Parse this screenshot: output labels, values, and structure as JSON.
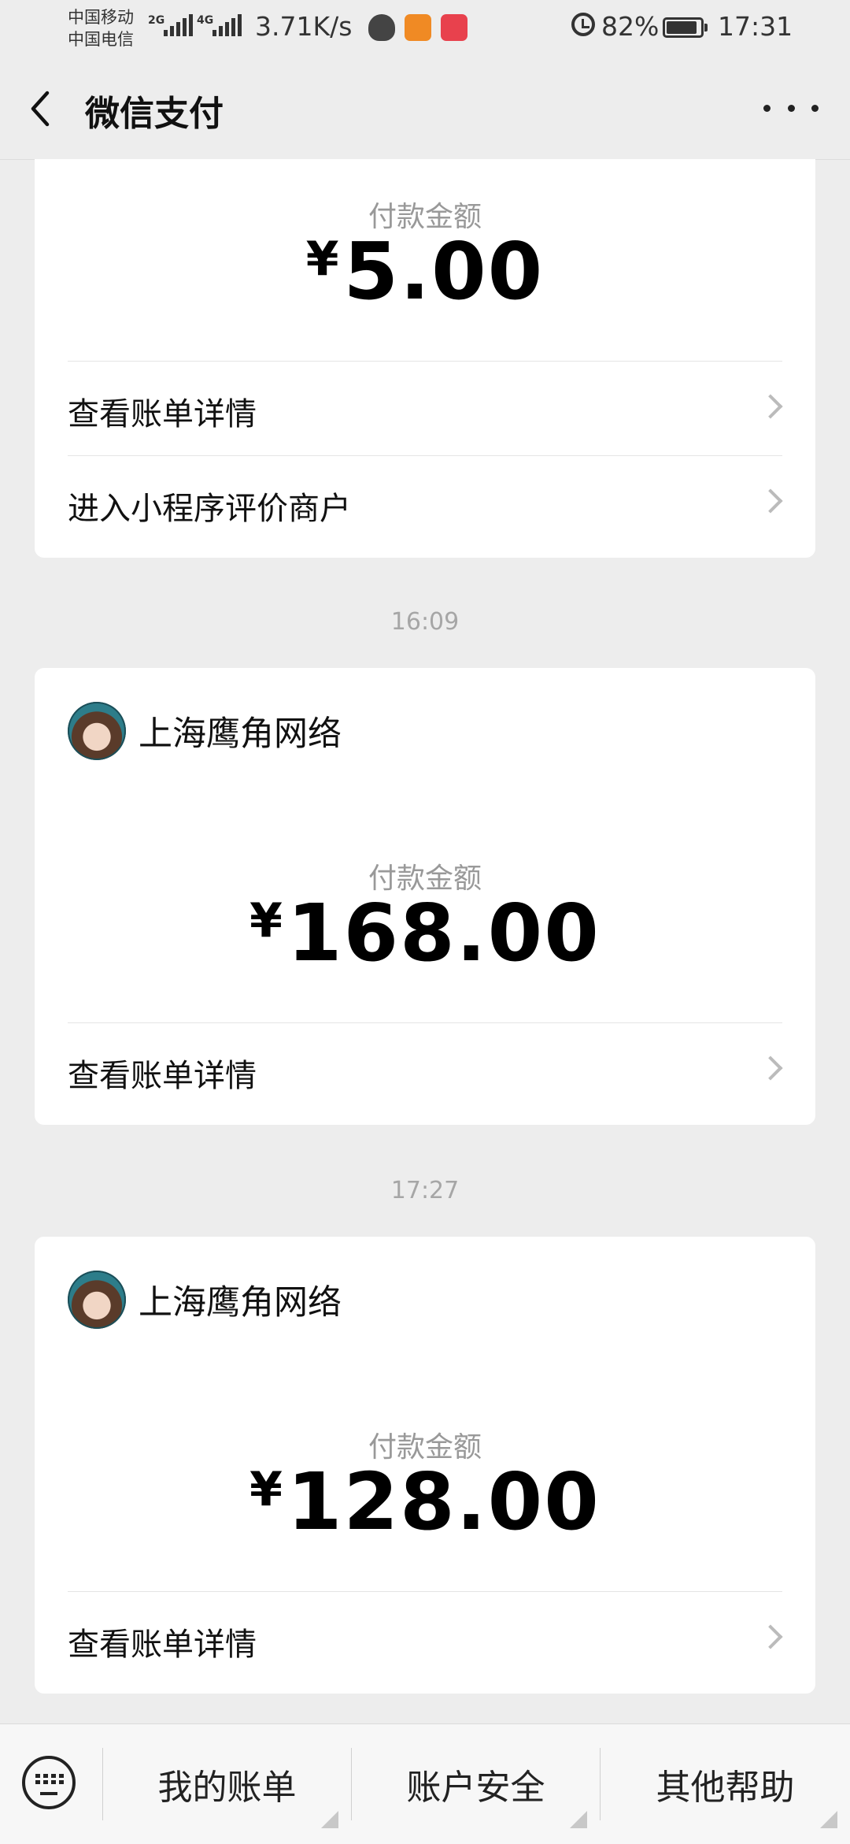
{
  "status_bar": {
    "carrier_1": "中国移动",
    "carrier_2": "中国电信",
    "net_1": "2G",
    "net_2": "4G",
    "speed": "3.71K/s",
    "battery": "82%",
    "time": "17:31",
    "app_icons": [
      "qq-icon",
      "uc-browser-icon",
      "reader-icon"
    ]
  },
  "nav": {
    "title": "微信支付"
  },
  "cards": [
    {
      "amount_label": "付款金额",
      "currency": "¥",
      "amount": "5.00",
      "rows": [
        "查看账单详情",
        "进入小程序评价商户"
      ]
    },
    {
      "time": "16:09",
      "merchant": "上海鹰角网络",
      "amount_label": "付款金额",
      "currency": "¥",
      "amount": "168.00",
      "rows": [
        "查看账单详情"
      ]
    },
    {
      "time": "17:27",
      "merchant": "上海鹰角网络",
      "amount_label": "付款金额",
      "currency": "¥",
      "amount": "128.00",
      "rows": [
        "查看账单详情"
      ]
    }
  ],
  "bottom_tabs": [
    "我的账单",
    "账户安全",
    "其他帮助"
  ],
  "colors": {
    "background": "#ededed",
    "card": "#ffffff",
    "muted_text": "#999999"
  }
}
